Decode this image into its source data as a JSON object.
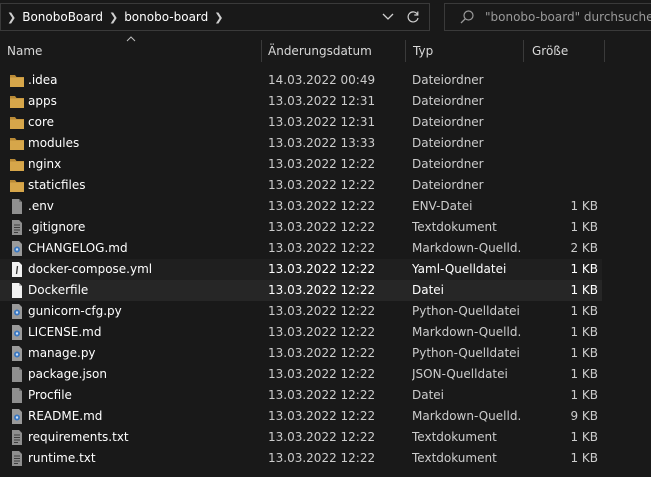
{
  "address": {
    "crumbs": [
      "BonoboBoard",
      "bonobo-board"
    ]
  },
  "search": {
    "placeholder": "\"bonobo-board\" durchsuchen"
  },
  "columns": {
    "name": "Name",
    "date": "Änderungsdatum",
    "type": "Typ",
    "size": "Größe"
  },
  "files": [
    {
      "name": ".idea",
      "date": "14.03.2022 00:49",
      "type": "Dateiordner",
      "size": "",
      "icon": "folder-icon"
    },
    {
      "name": "apps",
      "date": "13.03.2022 12:31",
      "type": "Dateiordner",
      "size": "",
      "icon": "folder-icon"
    },
    {
      "name": "core",
      "date": "13.03.2022 12:31",
      "type": "Dateiordner",
      "size": "",
      "icon": "folder-icon"
    },
    {
      "name": "modules",
      "date": "13.03.2022 13:33",
      "type": "Dateiordner",
      "size": "",
      "icon": "folder-icon"
    },
    {
      "name": "nginx",
      "date": "13.03.2022 12:22",
      "type": "Dateiordner",
      "size": "",
      "icon": "folder-icon"
    },
    {
      "name": "staticfiles",
      "date": "13.03.2022 12:22",
      "type": "Dateiordner",
      "size": "",
      "icon": "folder-icon"
    },
    {
      "name": ".env",
      "date": "13.03.2022 12:22",
      "type": "ENV-Datei",
      "size": "1 KB",
      "icon": "file-icon"
    },
    {
      "name": ".gitignore",
      "date": "13.03.2022 12:22",
      "type": "Textdokument",
      "size": "1 KB",
      "icon": "text-file-icon"
    },
    {
      "name": "CHANGELOG.md",
      "date": "13.03.2022 12:22",
      "type": "Markdown-Quelld...",
      "size": "2 KB",
      "icon": "code-file-icon"
    },
    {
      "name": "docker-compose.yml",
      "date": "13.03.2022 12:22",
      "type": "Yaml-Quelldatei",
      "size": "1 KB",
      "icon": "yaml-file-icon"
    },
    {
      "name": "Dockerfile",
      "date": "13.03.2022 12:22",
      "type": "Datei",
      "size": "1 KB",
      "icon": "blank-file-icon"
    },
    {
      "name": "gunicorn-cfg.py",
      "date": "13.03.2022 12:22",
      "type": "Python-Quelldatei",
      "size": "1 KB",
      "icon": "code-file-icon"
    },
    {
      "name": "LICENSE.md",
      "date": "13.03.2022 12:22",
      "type": "Markdown-Quelld...",
      "size": "1 KB",
      "icon": "code-file-icon"
    },
    {
      "name": "manage.py",
      "date": "13.03.2022 12:22",
      "type": "Python-Quelldatei",
      "size": "1 KB",
      "icon": "code-file-icon"
    },
    {
      "name": "package.json",
      "date": "13.03.2022 12:22",
      "type": "JSON-Quelldatei",
      "size": "1 KB",
      "icon": "file-icon"
    },
    {
      "name": "Procfile",
      "date": "13.03.2022 12:22",
      "type": "Datei",
      "size": "1 KB",
      "icon": "file-icon"
    },
    {
      "name": "README.md",
      "date": "13.03.2022 12:22",
      "type": "Markdown-Quelld...",
      "size": "9 KB",
      "icon": "code-file-icon"
    },
    {
      "name": "requirements.txt",
      "date": "13.03.2022 12:22",
      "type": "Textdokument",
      "size": "1 KB",
      "icon": "text-file-icon"
    },
    {
      "name": "runtime.txt",
      "date": "13.03.2022 12:22",
      "type": "Textdokument",
      "size": "1 KB",
      "icon": "text-file-icon"
    }
  ],
  "colors": {
    "background": "#191919",
    "folder": "#d6a64a",
    "selected": "#262626"
  }
}
